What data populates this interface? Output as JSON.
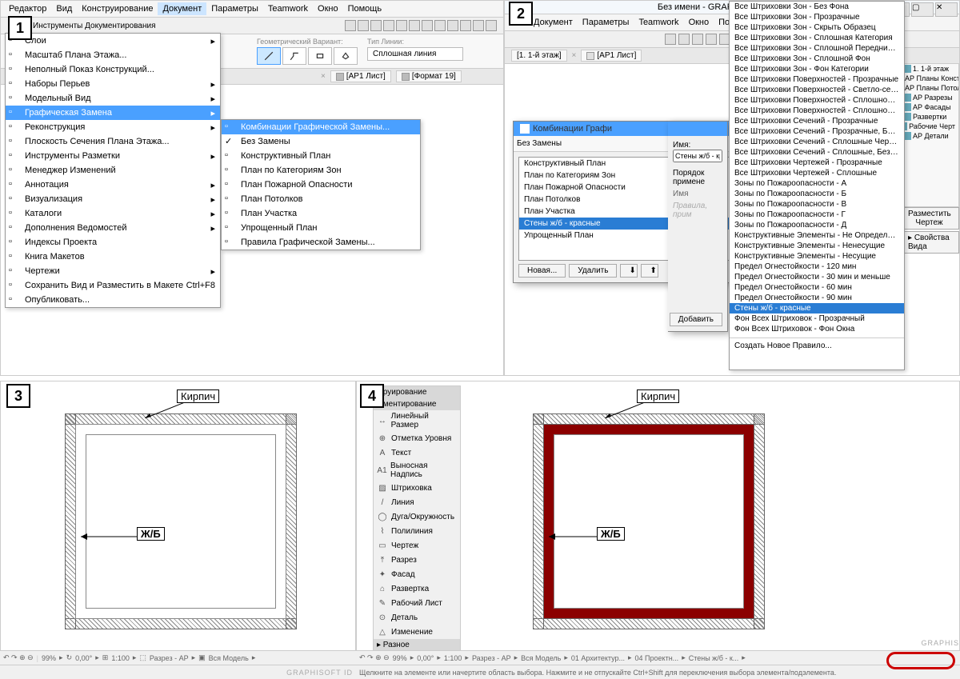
{
  "badges": [
    "1",
    "2",
    "3",
    "4"
  ],
  "p1": {
    "menubar": [
      "Редактор",
      "Вид",
      "Конструирование",
      "Документ",
      "Параметры",
      "Teamwork",
      "Окно",
      "Помощь"
    ],
    "menubar_active_index": 3,
    "ribbon_label": "Инструменты Документирования",
    "opt_geo": "Геометрический Вариант:",
    "opt_line": "Тип Линии:",
    "line_value": "Сплошная линия",
    "tabs": [
      "[АР1 Лист]",
      "[Формат 19]"
    ],
    "doc_menu": [
      {
        "t": "Слои",
        "a": true
      },
      {
        "t": "Масштаб Плана Этажа..."
      },
      {
        "t": "Неполный Показ Конструкций..."
      },
      {
        "t": "Наборы Перьев",
        "a": true
      },
      {
        "t": "Модельный Вид",
        "a": true
      },
      {
        "t": "Графическая Замена",
        "a": true,
        "hl": true
      },
      {
        "t": "Реконструкция",
        "a": true
      },
      {
        "t": "Плоскость Сечения Плана Этажа..."
      },
      {
        "t": "Инструменты Разметки",
        "a": true
      },
      {
        "t": "Менеджер Изменений"
      },
      {
        "t": "Аннотация",
        "a": true
      },
      {
        "t": "Визуализация",
        "a": true
      },
      {
        "t": "Каталоги",
        "a": true
      },
      {
        "t": "Дополнения Ведомостей",
        "a": true
      },
      {
        "t": "Индексы Проекта"
      },
      {
        "t": "Книга Макетов"
      },
      {
        "t": "Чертежи",
        "a": true
      },
      {
        "t": "Сохранить Вид и Разместить в Макете",
        "sc": "Ctrl+F8"
      },
      {
        "t": "Опубликовать..."
      }
    ],
    "submenu": [
      {
        "t": "Комбинации Графической Замены...",
        "hl": true
      },
      {
        "t": "Без Замены",
        "chk": true
      },
      {
        "t": "Конструктивный План"
      },
      {
        "t": "План по Категориям Зон"
      },
      {
        "t": "План Пожарной Опасности"
      },
      {
        "t": "План Потолков"
      },
      {
        "t": "План Участка"
      },
      {
        "t": "Упрощенный План"
      },
      {
        "t": "Правила Графической Замены..."
      }
    ]
  },
  "p2": {
    "title": "Без имени - GRAPHISOFT ARCHICA",
    "menubar": [
      "Документ",
      "Параметры",
      "Teamwork",
      "Окно",
      "Помощь"
    ],
    "tabs": [
      "[1. 1-й этаж]",
      "[АР1 Лист]"
    ],
    "dialog_title": "Комбинации Графи",
    "combo_header": "Без Замены",
    "combos": [
      "Конструктивный План",
      "План по Категориям Зон",
      "План Пожарной Опасности",
      "План Потолков",
      "План Участка",
      "Стены ж/б - красные",
      "Упрощенный План"
    ],
    "combo_selected_index": 5,
    "right_name": "Имя:",
    "right_value": "Стены ж/б - красн",
    "order": "Порядок примене",
    "order_name": "Имя",
    "placeholder": "Правила, прим",
    "btn_new": "Новая...",
    "btn_del": "Удалить",
    "btn_add": "Добавить",
    "rules": [
      "Все Штриховки Зон - Без Фона",
      "Все Штриховки Зон - Прозрачные",
      "Все Штриховки Зон - Скрыть Образец",
      "Все Штриховки Зон - Сплошная Категория",
      "Все Штриховки Зон - Сплошной Передний План",
      "Все Штриховки Зон - Сплошной Фон",
      "Все Штриховки Зон - Фон Категории",
      "Все Штриховки Поверхностей - Прозрачные",
      "Все Штриховки Поверхностей - Светло-серые",
      "Все Штриховки Поверхностей - Сплошной Передний План",
      "Все Штриховки Поверхностей - Сплошной Фон",
      "Все Штриховки Сечений - Прозрачные",
      "Все Штриховки Сечений - Прозрачные, Без Разделителей Слоев",
      "Все Штриховки Сечений - Сплошные Черные",
      "Все Штриховки Сечений - Сплошные, Без Разделителей Слоев",
      "Все Штриховки Чертежей - Прозрачные",
      "Все Штриховки Чертежей - Сплошные",
      "Зоны по Пожароопасности - А",
      "Зоны по Пожароопасности - Б",
      "Зоны по Пожароопасности - В",
      "Зоны по Пожароопасности - Г",
      "Зоны по Пожароопасности - Д",
      "Конструктивные Элементы - Не Определены",
      "Конструктивные Элементы - Ненесущие",
      "Конструктивные Элементы - Несущие",
      "Предел Огнестойкости - 120 мин",
      "Предел Огнестойкости - 30 мин и меньше",
      "Предел Огнестойкости - 60 мин",
      "Предел Огнестойкости - 90 мин",
      "Стены ж/б - красные",
      "Фон Всех Штриховок - Прозрачный",
      "Фон Всех Штриховок - Фон Окна"
    ],
    "rules_sel_index": 29,
    "create_new": "Создать Новое Правило...",
    "nav_items": [
      "1. 1-й этаж",
      "АР Планы Констр",
      "АР Планы Потол",
      "АР Разрезы",
      "АР Фасады",
      "Развертки",
      "Рабочие Черт",
      "АР Детали"
    ],
    "nav_btn1": "Разместить Чертеж",
    "nav_btn2": "Свойства Вида",
    "status": "Щелкните на элементе или начертите область выбора. Нажмите и не отпускайте Ctrl+Shift для переключения выбора элемента/подэлемента.",
    "sb_zoom": "99%",
    "sb_deg": "0,00°",
    "sb_scale": "1:100",
    "sb_razrez": "Разрез - АР",
    "sb_model": "Вся Модель",
    "sb_layer": "01 Архитектур...",
    "sb_proj": "04 Проектн...",
    "sb_override": "Стены ж/б - к..."
  },
  "p3": {
    "label_brick": "Кирпич",
    "label_rc": "Ж/Б",
    "sb_zoom": "99%",
    "sb_deg": "0,00°",
    "sb_scale": "1:100",
    "sb_razrez": "Разрез - АР",
    "sb_model": "Вся Модель",
    "sb_brand": "GRAPHISOFT ID"
  },
  "p4": {
    "tools_top": [
      "руирование",
      "ментирование"
    ],
    "tools": [
      {
        "i": "↔",
        "t": "Линейный Размер"
      },
      {
        "i": "⊕",
        "t": "Отметка Уровня"
      },
      {
        "i": "A",
        "t": "Текст"
      },
      {
        "i": "A1",
        "t": "Выносная Надпись"
      },
      {
        "i": "▨",
        "t": "Штриховка"
      },
      {
        "i": "/",
        "t": "Линия"
      },
      {
        "i": "◯",
        "t": "Дуга/Окружность"
      },
      {
        "i": "⌇",
        "t": "Полилиния"
      },
      {
        "i": "▭",
        "t": "Чертеж"
      },
      {
        "i": "⤒",
        "t": "Разрез"
      },
      {
        "i": "✦",
        "t": "Фасад"
      },
      {
        "i": "⌂",
        "t": "Развертка"
      },
      {
        "i": "✎",
        "t": "Рабочий Лист"
      },
      {
        "i": "⊙",
        "t": "Деталь"
      },
      {
        "i": "△",
        "t": "Изменение"
      }
    ],
    "tools_footer": "Разное",
    "label_brick": "Кирпич",
    "label_rc": "Ж/Б",
    "sb_brand": "GRAPHIS"
  }
}
